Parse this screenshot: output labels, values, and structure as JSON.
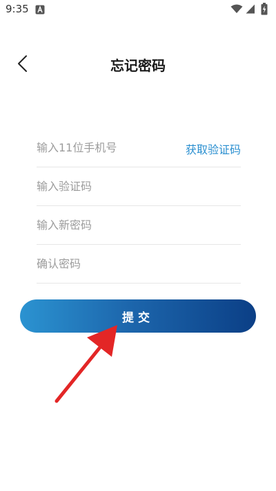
{
  "status_bar": {
    "time": "9:35",
    "icons": [
      "notification-a-icon",
      "wifi-icon",
      "cell-signal-icon",
      "battery-charging-icon"
    ]
  },
  "header": {
    "back_icon": "chevron-left-icon",
    "title": "忘记密码"
  },
  "form": {
    "phone_placeholder": "输入11位手机号",
    "get_code_label": "获取验证码",
    "code_placeholder": "输入验证码",
    "new_password_placeholder": "输入新密码",
    "confirm_password_placeholder": "确认密码"
  },
  "submit": {
    "label": "提交"
  },
  "colors": {
    "accent_link": "#2a8fd0",
    "button_gradient_start": "#2b93d1",
    "button_gradient_end": "#0b3f86",
    "annotation_arrow": "#e32626"
  }
}
